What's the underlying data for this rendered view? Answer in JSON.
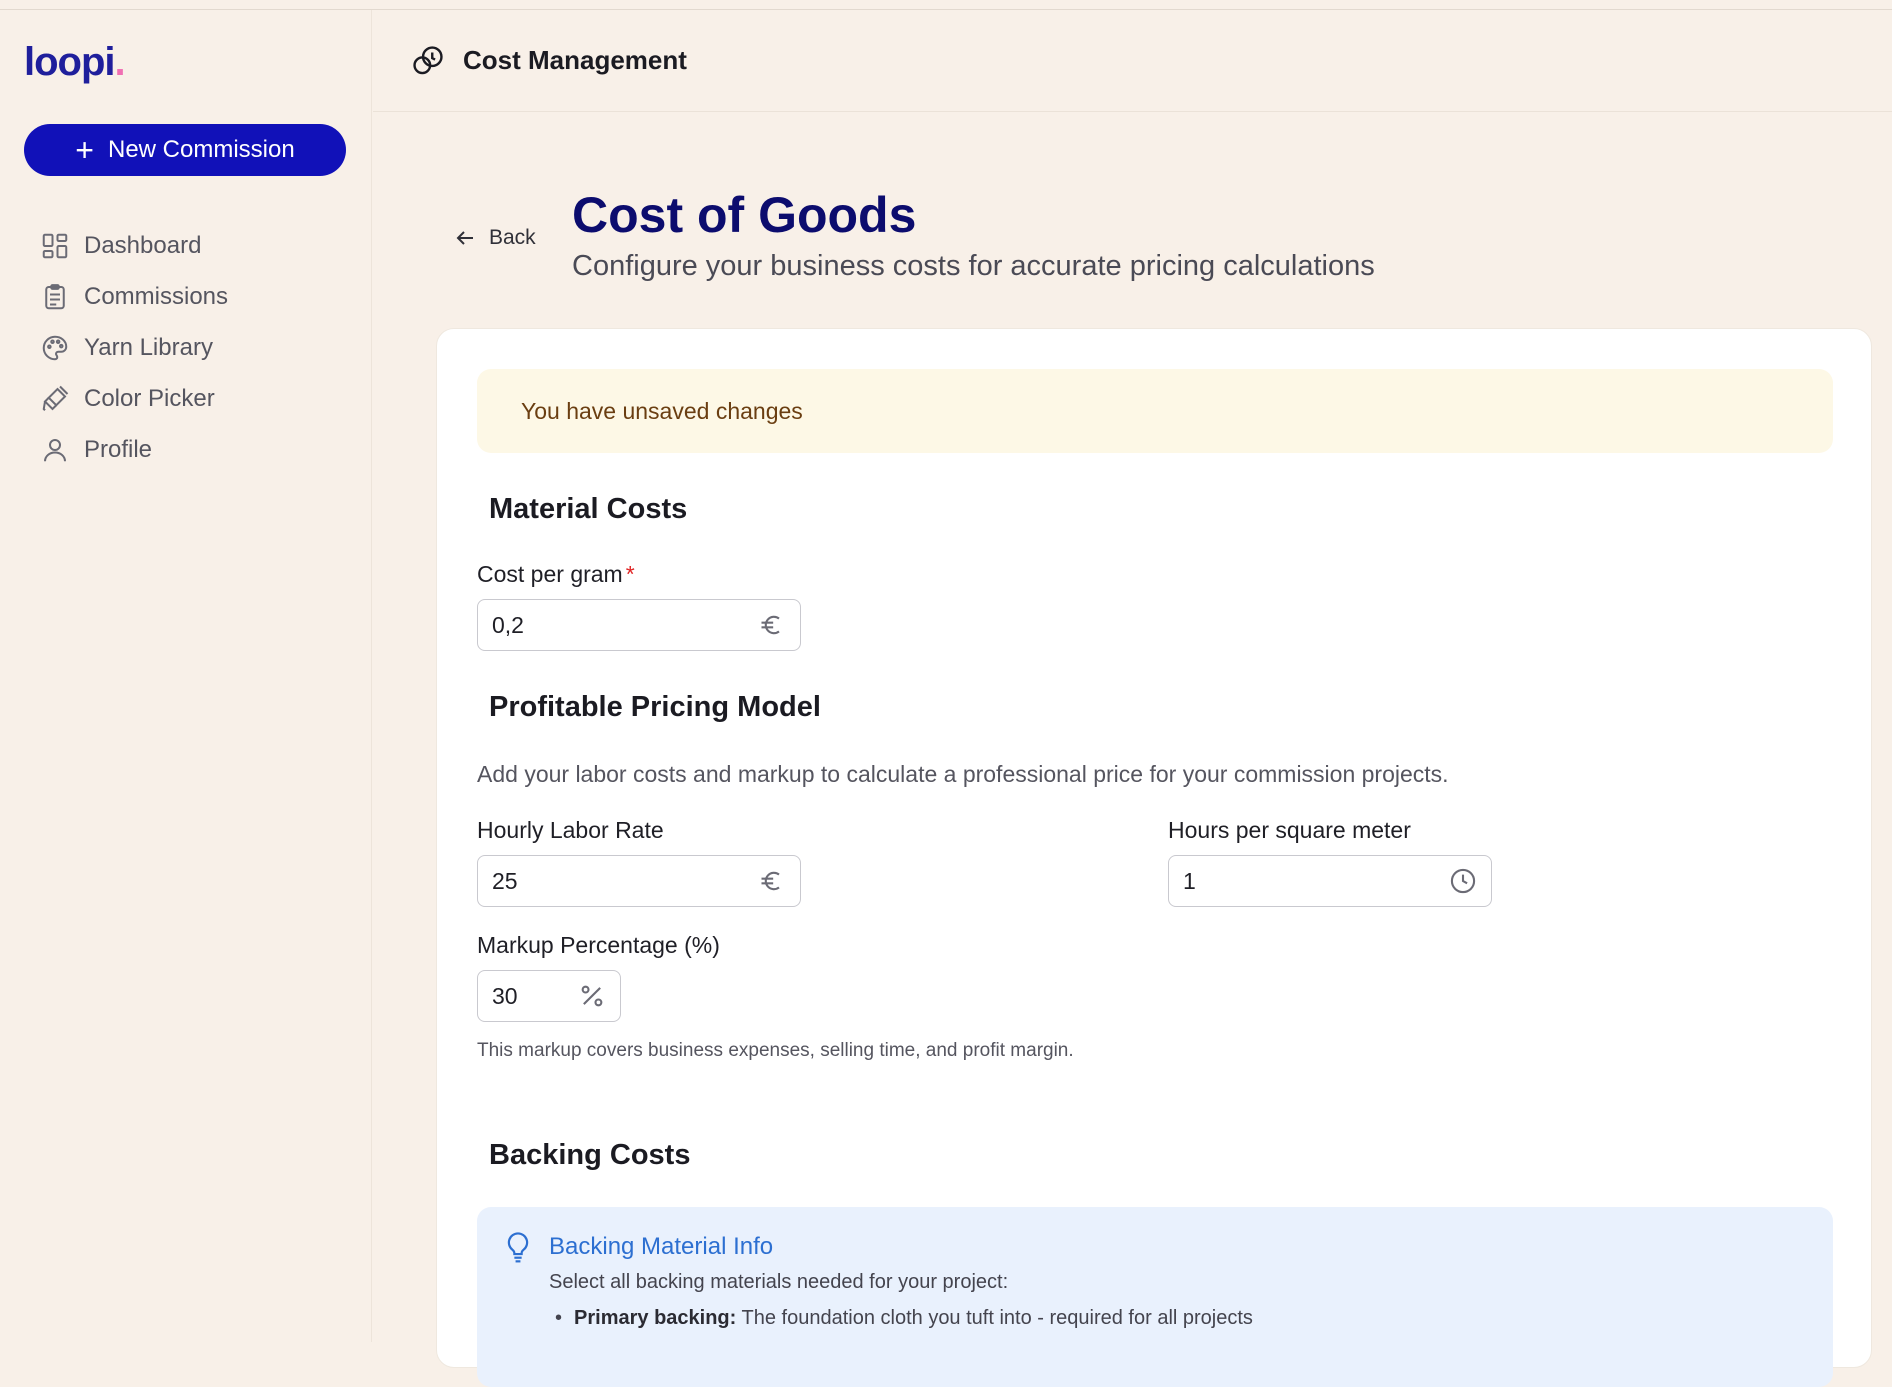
{
  "app": {
    "logo_text": "loopi",
    "logo_dot": ".",
    "logo_dot_color": "#f06fb3",
    "accent": "#1111b8"
  },
  "sidebar": {
    "new_button_label": "New Commission",
    "items": [
      {
        "label": "Dashboard",
        "icon": "dashboard-icon"
      },
      {
        "label": "Commissions",
        "icon": "clipboard-icon"
      },
      {
        "label": "Yarn Library",
        "icon": "palette-icon"
      },
      {
        "label": "Color Picker",
        "icon": "brush-icon"
      },
      {
        "label": "Profile",
        "icon": "user-icon"
      }
    ]
  },
  "header": {
    "title": "Cost Management",
    "icon": "coins-icon"
  },
  "page": {
    "back_label": "Back",
    "title": "Cost of Goods",
    "subtitle": "Configure your business costs for accurate pricing calculations"
  },
  "alert": {
    "text": "You have unsaved changes",
    "color": "#fdf8e6"
  },
  "material": {
    "title": "Material Costs",
    "cost_per_gram_label": "Cost per gram",
    "required_mark": "*",
    "cost_per_gram_value": "0,2",
    "currency_icon": "euro-icon"
  },
  "pricing": {
    "title": "Profitable Pricing Model",
    "description": "Add your labor costs and markup to calculate a professional price for your commission projects.",
    "hourly_label": "Hourly Labor Rate",
    "hourly_value": "25",
    "hours_label": "Hours per square meter",
    "hours_value": "1",
    "markup_label": "Markup Percentage (%)",
    "markup_value": "30",
    "markup_help": "This markup covers business expenses, selling time, and profit margin."
  },
  "backing": {
    "title": "Backing Costs",
    "info_title": "Backing Material Info",
    "info_text": "Select all backing materials needed for your project:",
    "bullet_bold": "Primary backing:",
    "bullet_text": "The foundation cloth you tuft into - required for all projects"
  }
}
